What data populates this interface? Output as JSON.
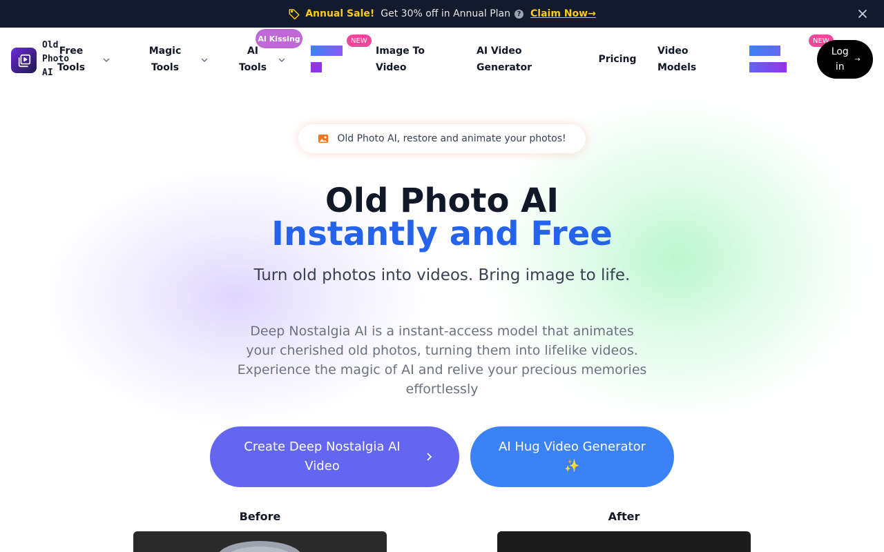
{
  "announcement": {
    "sale_label": "Annual Sale!",
    "offer_text": "Get 30% off in Annual Plan",
    "help_glyph": "?",
    "claim_label": "Claim Now→",
    "colors": {
      "background": "#131a2b",
      "accent": "#facc15"
    }
  },
  "nav": {
    "logo_text": "Old Photo AI",
    "items": [
      {
        "label": "Free Tools"
      },
      {
        "label": "Magic Tools"
      },
      {
        "label": "AI Tools"
      },
      {
        "label": "Image To Video"
      },
      {
        "label": "AI Video Generator"
      },
      {
        "label": "Pricing"
      },
      {
        "label": "Video Models"
      }
    ],
    "badges": {
      "ai_kissing": "AI Kissing",
      "new_1": "NEW",
      "new_2": "NEW"
    },
    "login_label": "Log in",
    "login_arrow": "→"
  },
  "hero": {
    "pill_text": "Old Photo AI, restore and animate your photos!",
    "title_line1": "Old Photo AI",
    "title_line2": "Instantly and Free",
    "subtitle": "Turn old photos into videos. Bring image to life.",
    "description": "Deep Nostalgia AI is a instant-access model that animates your cherished old photos, turning them into lifelike videos. Experience the magic of AI and relive your precious memories effortlessly",
    "primary_button": "Create Deep Nostalgia AI Video",
    "secondary_button": "AI Hug Video Generator ✨",
    "colors": {
      "title_accent": "#2563eb",
      "primary": "#6366f1",
      "secondary": "#3b82f6"
    }
  },
  "comparison": {
    "before_label": "Before",
    "after_label": "After"
  }
}
